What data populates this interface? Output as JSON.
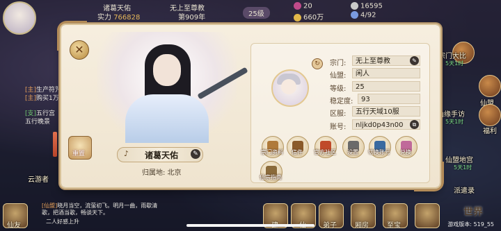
{
  "topbar": {
    "player_name": "诸葛天佑",
    "sect": "无上至尊教",
    "power_label": "实力",
    "power_value": "766828",
    "years": "第909年",
    "level": "25级",
    "gem": "20",
    "silver": "16595",
    "gold": "660万",
    "ticket": "4/92"
  },
  "chat": [
    {
      "tag": "[主]",
      "text": "生产符咒"
    },
    {
      "tag": "[主]",
      "text": "购买1万份"
    },
    {
      "tag": "[支]",
      "text": "五行宫"
    },
    {
      "tag": "",
      "text": "五行晚景"
    },
    {
      "tag": "[仙盟]",
      "text": "晓月当空，流萤初飞。明月一曲，雨歇清歌，把酒当歌，畅谈天下。"
    },
    {
      "tag": "",
      "text": "二人好感上升"
    }
  ],
  "right_menu": [
    {
      "label": "宗门大比",
      "sub": "5天1时"
    },
    {
      "label": "仙盟",
      "sub": ""
    },
    {
      "label": "仙缘手访",
      "sub": "5天1时"
    },
    {
      "label": "福利",
      "sub": ""
    },
    {
      "label": "仙盟地宫",
      "sub": "5天1时"
    },
    {
      "label": "派遣录",
      "sub": ""
    }
  ],
  "bottom": {
    "left_label": "仙友",
    "labels": [
      "建",
      "仙",
      "弟子",
      "厢房",
      "至宝",
      "世界"
    ],
    "version": "游戏版本: 519_55",
    "left_tab": "云游者"
  },
  "profile": {
    "char_name": "诸葛天佑",
    "home_label": "归属地: 北京",
    "badge_text": "重置",
    "fields": [
      {
        "key": "宗门:",
        "value": "无上至尊教",
        "button": true
      },
      {
        "key": "仙盟:",
        "value": "闲人",
        "button": false
      },
      {
        "key": "等级:",
        "value": "25",
        "button": false
      },
      {
        "key": "稳定度:",
        "value": "93",
        "button": false
      },
      {
        "key": "区服:",
        "value": "五行天域10服",
        "button": false
      },
      {
        "key": "账号:",
        "value": "nljkd0p43n00",
        "button": true
      }
    ],
    "functions": [
      {
        "label": "宗门资料",
        "color": "#b07a3a"
      },
      {
        "label": "信件",
        "color": "#8a5a2a"
      },
      {
        "label": "官方社区",
        "color": "#c04a2a"
      },
      {
        "label": "设置",
        "color": "#6a6a6a"
      },
      {
        "label": "切换账号",
        "color": "#3a6aa0"
      },
      {
        "label": "兑换",
        "color": "#c06a9a"
      },
      {
        "label": "仙宗指南",
        "color": "#8a6a3a"
      }
    ]
  }
}
